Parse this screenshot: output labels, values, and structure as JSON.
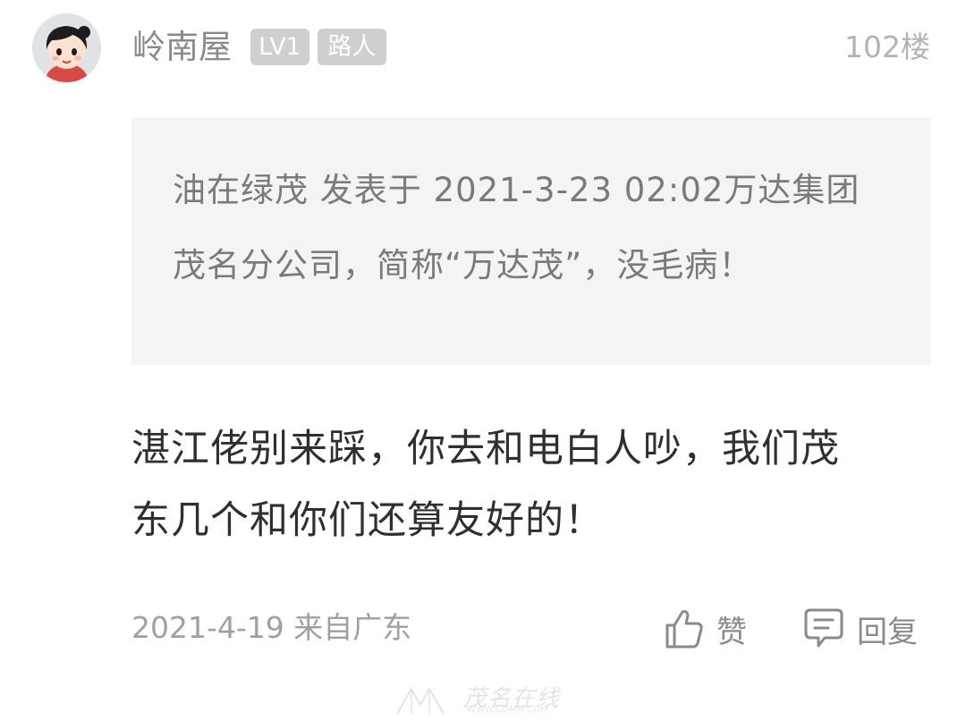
{
  "post": {
    "username": "岭南屋",
    "level_badge": "LV1",
    "role_badge": "路人",
    "floor": "102楼",
    "quote": "油在绿茂 发表于 2021-3-23 02:02万达集团茂名分公司，简称“万达茂”，没毛病！",
    "content": "湛江佬别来踩，你去和电白人吵，我们茂东几个和你们还算友好的！",
    "meta": "2021-4-19 来自广东",
    "like_label": "赞",
    "reply_label": "回复"
  },
  "watermark": {
    "text": "茂名在线",
    "url": "WWW.GDMM.COM"
  },
  "icons": {
    "like": "thumbs-up-icon",
    "reply": "comment-icon"
  },
  "colors": {
    "badge": "#cfcfcf",
    "quote_background": "#f4f4f4",
    "muted_text": "#a0a0a0"
  }
}
